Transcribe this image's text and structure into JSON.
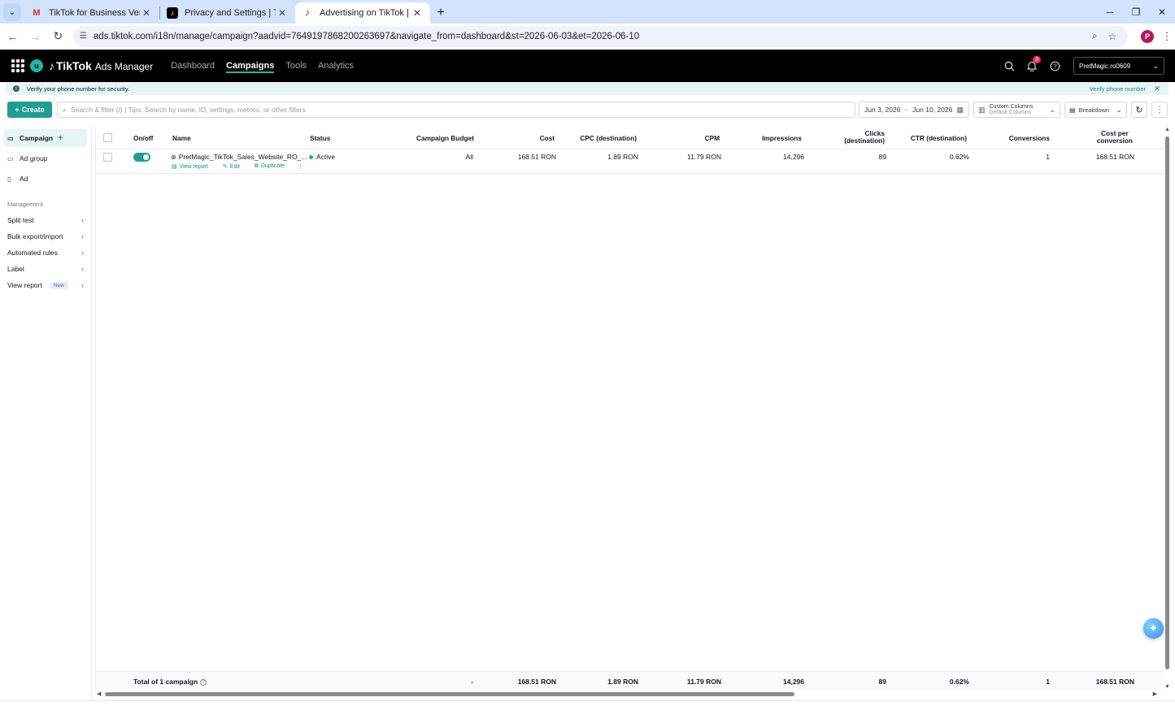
{
  "browser": {
    "tabs": [
      {
        "title": "TikTok for Business Verification",
        "favicon": "gmail-icon",
        "active": false
      },
      {
        "title": "Privacy and Settings | TikTok",
        "favicon": "tiktok-icon",
        "active": false
      },
      {
        "title": "Advertising on TikTok | TikTok A",
        "favicon": "tiktok-icon",
        "active": true
      }
    ],
    "url": "ads.tiktok.com/i18n/manage/campaign?aadvid=7649197868200263697&navigate_from=dashboard&st=2026-06-03&et=2026-06-10",
    "profile_initial": "P"
  },
  "header": {
    "avatar_initial": "u",
    "brand_name": "TikTok",
    "brand_suffix": "Ads Manager",
    "nav": [
      {
        "label": "Dashboard",
        "active": false
      },
      {
        "label": "Campaigns",
        "active": true
      },
      {
        "label": "Tools",
        "active": false
      },
      {
        "label": "Analytics",
        "active": false
      }
    ],
    "notification_count": "3",
    "account": "PretMagic.ro0609"
  },
  "banner": {
    "message": "Verify your phone number for security.",
    "link": "Verify phone number"
  },
  "toolbar": {
    "create_label": "Create",
    "search_placeholder": "Search & filter (/) | Tips: Search by name, ID, settings, metrics, or other filters",
    "date_start": "Jun 3, 2026",
    "date_sep": "–",
    "date_end": "Jun 10, 2026",
    "columns_title": "Custom Columns",
    "columns_sub": "Default Columns",
    "breakdown_label": "Breakdown"
  },
  "sidebar": {
    "levels": [
      {
        "label": "Campaign",
        "active": true
      },
      {
        "label": "Ad group",
        "active": false
      },
      {
        "label": "Ad",
        "active": false
      }
    ],
    "management_title": "Management",
    "management": [
      {
        "label": "Split test"
      },
      {
        "label": "Bulk export/import"
      },
      {
        "label": "Automated rules"
      },
      {
        "label": "Label"
      },
      {
        "label": "View report",
        "badge": "New"
      }
    ]
  },
  "table": {
    "columns": {
      "onoff": "On/off",
      "name": "Name",
      "status": "Status",
      "budget": "Campaign Budget",
      "cost": "Cost",
      "cpc": "CPC (destination)",
      "cpm": "CPM",
      "impressions": "Impressions",
      "clicks_1": "Clicks",
      "clicks_2": "(destination)",
      "ctr": "CTR (destination)",
      "conversions": "Conversions",
      "cpconv_1": "Cost per",
      "cpconv_2": "conversion"
    },
    "rows": [
      {
        "enabled": true,
        "name": "PretMagic_TikTok_Sales_Website_RO_...",
        "actions": {
          "view_report": "View report",
          "edit": "Edit",
          "duplicate": "Duplicate"
        },
        "status": "Active",
        "budget": "All",
        "cost": "168.51 RON",
        "cpc": "1.89 RON",
        "cpm": "11.79 RON",
        "impressions": "14,296",
        "clicks": "89",
        "ctr": "0.62%",
        "conversions": "1",
        "cost_per_conversion": "168.51 RON"
      }
    ],
    "total": {
      "label": "Total of 1 campaign",
      "budget": "-",
      "cost": "168.51 RON",
      "cpc": "1.89 RON",
      "cpm": "11.79 RON",
      "impressions": "14,296",
      "clicks": "89",
      "ctr": "0.62%",
      "conversions": "1",
      "cost_per_conversion": "168.51 RON"
    }
  },
  "colors": {
    "accent": "#1f9e94",
    "active_dot": "#25b56b",
    "header_bg": "#000000"
  }
}
